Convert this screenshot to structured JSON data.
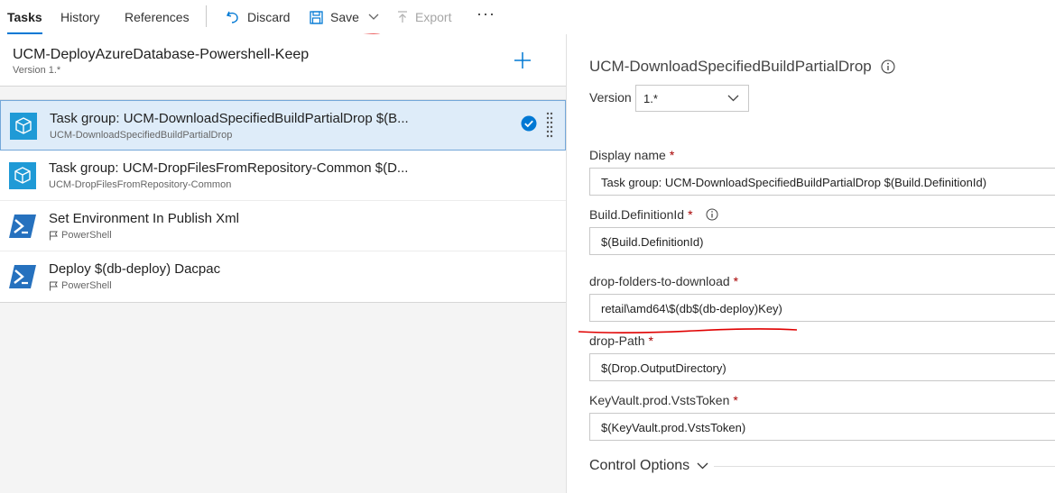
{
  "toolbar": {
    "tabs": [
      {
        "label": "Tasks",
        "active": true
      },
      {
        "label": "History",
        "active": false
      },
      {
        "label": "References",
        "active": false
      }
    ],
    "discard_label": "Discard",
    "save_label": "Save",
    "export_label": "Export",
    "more_label": "···"
  },
  "phase": {
    "title": "UCM-DeployAzureDatabase-Powershell-Keep",
    "version": "Version 1.*"
  },
  "tasks": [
    {
      "title": "Task group: UCM-DownloadSpecifiedBuildPartialDrop $(B...",
      "subtitle": "UCM-DownloadSpecifiedBuildPartialDrop",
      "icon": "task-group-icon",
      "selected": true
    },
    {
      "title": "Task group: UCM-DropFilesFromRepository-Common $(D...",
      "subtitle": "UCM-DropFilesFromRepository-Common",
      "icon": "task-group-icon",
      "selected": false
    },
    {
      "title": "Set Environment In Publish Xml",
      "subtitle": "PowerShell",
      "icon": "powershell-icon",
      "selected": false
    },
    {
      "title": "Deploy $(db-deploy) Dacpac",
      "subtitle": "PowerShell",
      "icon": "powershell-icon",
      "selected": false
    }
  ],
  "details": {
    "title": "UCM-DownloadSpecifiedBuildPartialDrop",
    "version_label": "Version",
    "version_value": "1.*",
    "fields": [
      {
        "label": "Display name",
        "required": "*",
        "value": "Task group: UCM-DownloadSpecifiedBuildPartialDrop $(Build.DefinitionId)",
        "info": false
      },
      {
        "label": "Build.DefinitionId",
        "required": "*",
        "value": "$(Build.DefinitionId)",
        "info": true
      },
      {
        "label": "drop-folders-to-download",
        "required": "*",
        "value": "retail\\amd64\\$(db$(db-deploy)Key)",
        "info": false
      },
      {
        "label": "drop-Path",
        "required": "*",
        "value": "$(Drop.OutputDirectory)",
        "info": false
      },
      {
        "label": "KeyVault.prod.VstsToken",
        "required": "*",
        "value": "$(KeyVault.prod.VstsToken)",
        "info": false
      }
    ],
    "control_options_label": "Control Options"
  },
  "colors": {
    "accent": "#0078d4",
    "selected_bg": "#deecf9",
    "annotation_red": "#e00000",
    "required_red": "#a80000"
  }
}
